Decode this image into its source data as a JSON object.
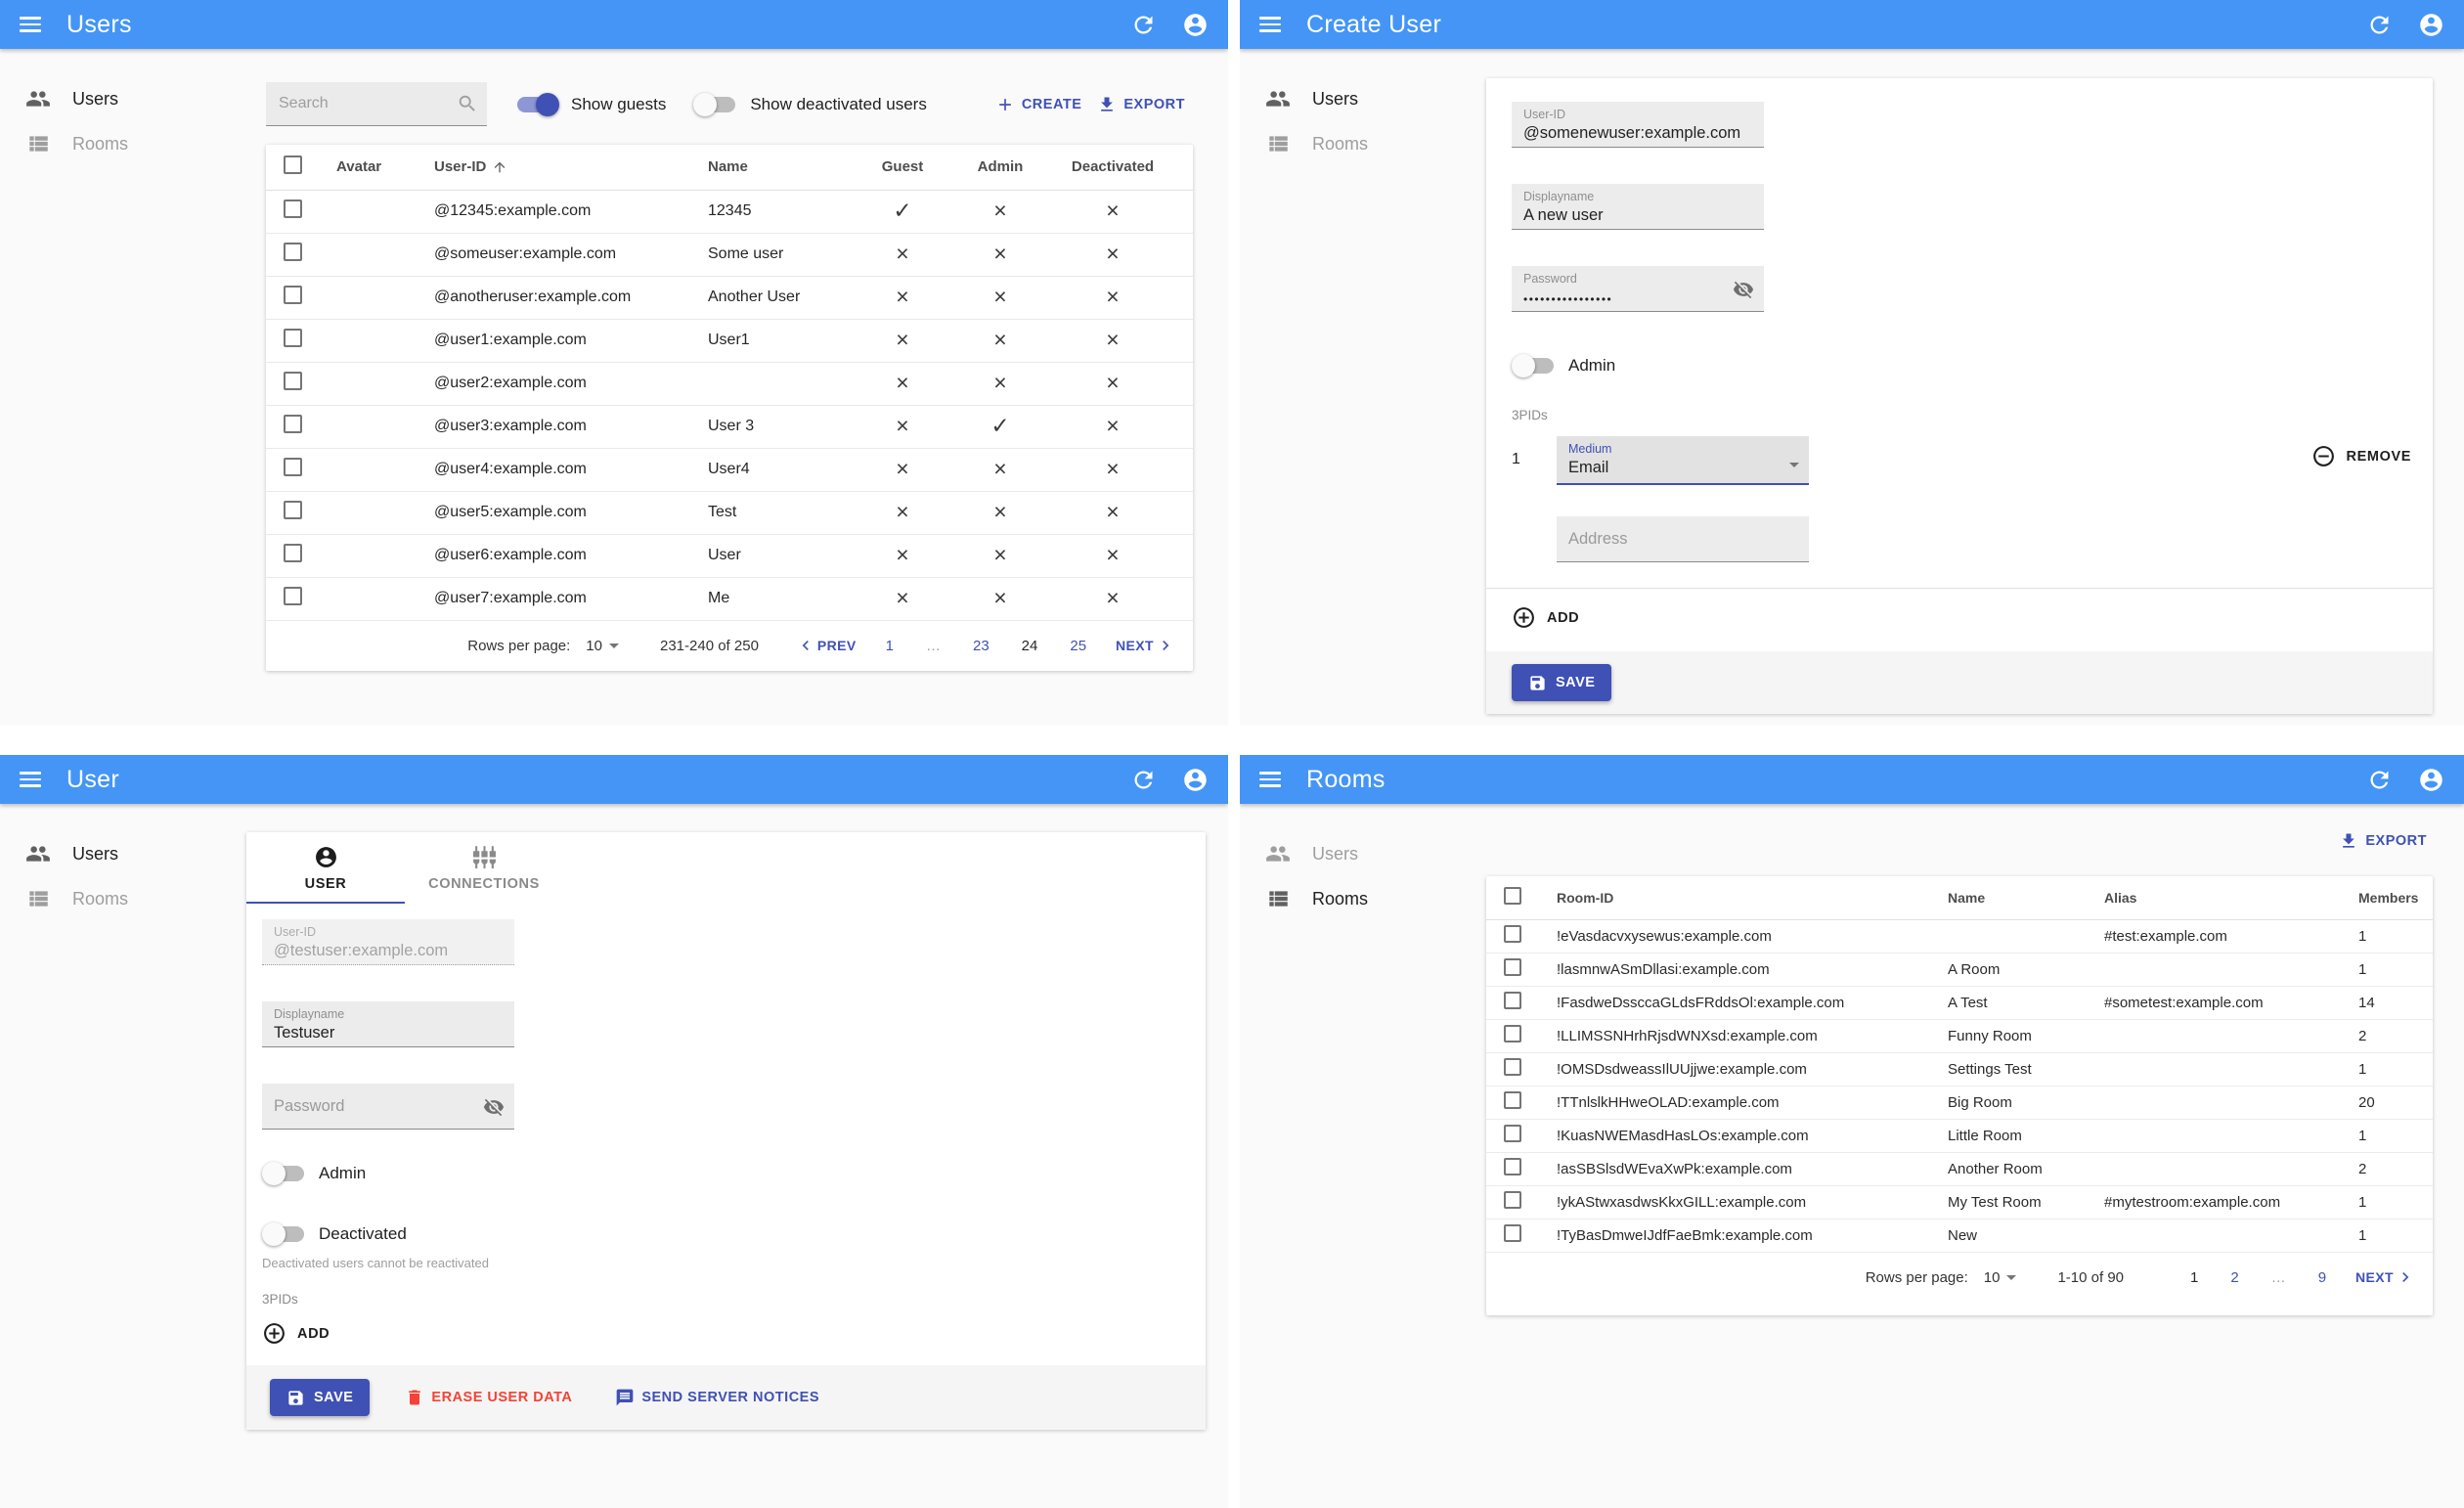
{
  "colors": {
    "appbar": "#4495f6",
    "primary": "#3f51b5",
    "danger": "#f44336"
  },
  "sidebar": {
    "users": "Users",
    "rooms": "Rooms"
  },
  "users_list": {
    "title": "Users",
    "search_placeholder": "Search",
    "show_guests": "Show guests",
    "show_deactivated": "Show deactivated users",
    "create": "CREATE",
    "export": "EXPORT",
    "headers": {
      "avatar": "Avatar",
      "user_id": "User-ID",
      "name": "Name",
      "guest": "Guest",
      "admin": "Admin",
      "deactivated": "Deactivated"
    },
    "rows": [
      {
        "user_id": "@12345:example.com",
        "name": "12345",
        "guest": "✓",
        "admin": "×",
        "deactivated": "×"
      },
      {
        "user_id": "@someuser:example.com",
        "name": "Some user",
        "guest": "×",
        "admin": "×",
        "deactivated": "×"
      },
      {
        "user_id": "@anotheruser:example.com",
        "name": "Another User",
        "guest": "×",
        "admin": "×",
        "deactivated": "×"
      },
      {
        "user_id": "@user1:example.com",
        "name": "User1",
        "guest": "×",
        "admin": "×",
        "deactivated": "×"
      },
      {
        "user_id": "@user2:example.com",
        "name": "",
        "guest": "×",
        "admin": "×",
        "deactivated": "×"
      },
      {
        "user_id": "@user3:example.com",
        "name": "User 3",
        "guest": "×",
        "admin": "✓",
        "deactivated": "×"
      },
      {
        "user_id": "@user4:example.com",
        "name": "User4",
        "guest": "×",
        "admin": "×",
        "deactivated": "×"
      },
      {
        "user_id": "@user5:example.com",
        "name": "Test",
        "guest": "×",
        "admin": "×",
        "deactivated": "×"
      },
      {
        "user_id": "@user6:example.com",
        "name": "User",
        "guest": "×",
        "admin": "×",
        "deactivated": "×"
      },
      {
        "user_id": "@user7:example.com",
        "name": "Me",
        "guest": "×",
        "admin": "×",
        "deactivated": "×"
      }
    ],
    "pagination": {
      "label": "Rows per page:",
      "per_page": "10",
      "range": "231-240 of 250",
      "prev": "PREV",
      "next": "NEXT",
      "pages": [
        "1",
        "…",
        "23",
        "24",
        "25"
      ]
    }
  },
  "create_user": {
    "title": "Create User",
    "user_id_label": "User-ID",
    "user_id": "@somenewuser:example.com",
    "displayname_label": "Displayname",
    "displayname": "A new user",
    "password_label": "Password",
    "password": "••••••••••••••••",
    "admin": "Admin",
    "threepids": "3PIDs",
    "row_num": "1",
    "medium_label": "Medium",
    "medium": "Email",
    "address_placeholder": "Address",
    "remove": "REMOVE",
    "add": "ADD",
    "save": "SAVE"
  },
  "user_edit": {
    "title": "User",
    "tab_user": "USER",
    "tab_connections": "CONNECTIONS",
    "user_id_label": "User-ID",
    "user_id": "@testuser:example.com",
    "displayname_label": "Displayname",
    "displayname": "Testuser",
    "password_placeholder": "Password",
    "admin": "Admin",
    "deactivated": "Deactivated",
    "deactivated_helper": "Deactivated users cannot be reactivated",
    "threepids": "3PIDs",
    "add": "ADD",
    "save": "SAVE",
    "erase": "ERASE USER DATA",
    "notices": "SEND SERVER NOTICES"
  },
  "rooms_list": {
    "title": "Rooms",
    "export": "EXPORT",
    "headers": {
      "room_id": "Room-ID",
      "name": "Name",
      "alias": "Alias",
      "members": "Members"
    },
    "rows": [
      {
        "room_id": "!eVasdacvxysewus:example.com",
        "name": "",
        "alias": "#test:example.com",
        "members": "1"
      },
      {
        "room_id": "!lasmnwASmDllasi:example.com",
        "name": "A Room",
        "alias": "",
        "members": "1"
      },
      {
        "room_id": "!FasdweDssccaGLdsFRddsOl:example.com",
        "name": "A Test",
        "alias": "#sometest:example.com",
        "members": "14"
      },
      {
        "room_id": "!LLIMSSNHrhRjsdWNXsd:example.com",
        "name": "Funny Room",
        "alias": "",
        "members": "2"
      },
      {
        "room_id": "!OMSDsdweassIlUUjjwe:example.com",
        "name": "Settings Test",
        "alias": "",
        "members": "1"
      },
      {
        "room_id": "!TTnlslkHHweOLAD:example.com",
        "name": "Big Room",
        "alias": "",
        "members": "20"
      },
      {
        "room_id": "!KuasNWEMasdHasLOs:example.com",
        "name": "Little Room",
        "alias": "",
        "members": "1"
      },
      {
        "room_id": "!asSBSlsdWEvaXwPk:example.com",
        "name": "Another Room",
        "alias": "",
        "members": "2"
      },
      {
        "room_id": "!ykAStwxasdwsKkxGILL:example.com",
        "name": "My Test Room",
        "alias": "#mytestroom:example.com",
        "members": "1"
      },
      {
        "room_id": "!TyBasDmweIJdfFaeBmk:example.com",
        "name": "New",
        "alias": "",
        "members": "1"
      }
    ],
    "pagination": {
      "label": "Rows per page:",
      "per_page": "10",
      "range": "1-10 of 90",
      "next": "NEXT",
      "pages": [
        "1",
        "2",
        "…",
        "9"
      ]
    }
  }
}
